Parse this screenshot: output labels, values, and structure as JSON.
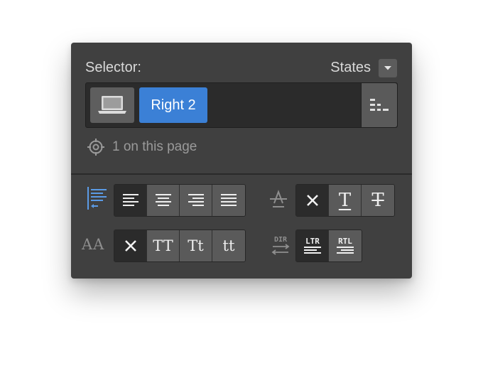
{
  "selector": {
    "label": "Selector:",
    "states_label": "States",
    "class_tag": "Right 2",
    "count_text": "1 on this page"
  },
  "colors": {
    "panel_bg": "#404040",
    "tag_blue": "#3b80d6",
    "active_icon_blue": "#5b9be6"
  },
  "icons": {
    "device": "laptop-icon",
    "settings": "selector-settings-icon",
    "count": "crosshair-icon",
    "states_dropdown": "chevron-down-icon",
    "alignment": "text-align-icon",
    "decoration": "text-decoration-icon",
    "capitalize": "text-case-icon",
    "direction": "text-direction-icon"
  },
  "alignment": {
    "active_index": 0,
    "options": [
      "align-left-icon",
      "align-center-icon",
      "align-right-icon",
      "align-justify-icon"
    ]
  },
  "decoration": {
    "active_index": 0,
    "options": [
      "none-x-icon",
      "underline-icon",
      "strikethrough-icon"
    ],
    "underline_glyph": "T",
    "strike_glyph": "T"
  },
  "capitalize": {
    "label": "AA",
    "active_index": 0,
    "options": [
      "none",
      "TT",
      "Tt",
      "tt"
    ]
  },
  "direction": {
    "label": "DIR",
    "active_index": 0,
    "options": [
      "LTR",
      "RTL"
    ]
  }
}
